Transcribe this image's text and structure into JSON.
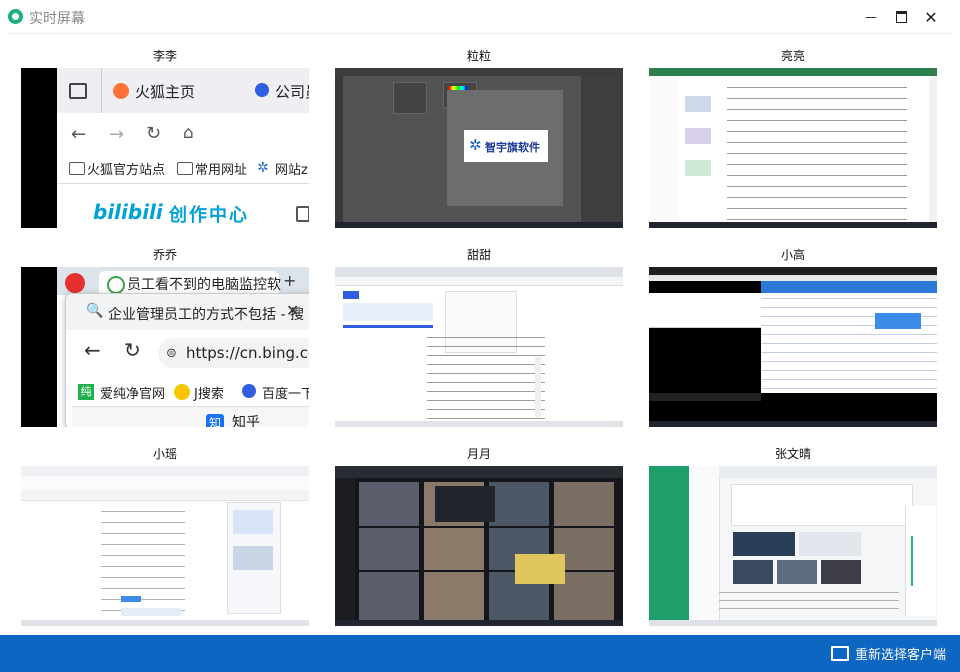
{
  "window": {
    "title": "实时屏幕"
  },
  "footer": {
    "reselect_label": "重新选择客户端"
  },
  "grid": [
    {
      "name": "李李",
      "screen": "firefox",
      "text": {
        "tab1": "火狐主页",
        "tab2": "公司员",
        "bm1": "火狐官方站点",
        "bm2": "常用网址",
        "bm3": "网站z",
        "banner_brand": "bilibili",
        "banner_text": "创作中心"
      }
    },
    {
      "name": "粒粒",
      "screen": "ps",
      "text": {
        "logo": "智宇旗软件"
      }
    },
    {
      "name": "亮亮",
      "screen": "doc",
      "text": {}
    },
    {
      "name": "乔乔",
      "screen": "chrome",
      "text": {
        "tab": "员工看不到的电脑监控软",
        "search": "企业管理员工的方式不包括 - 搜",
        "url": "https://cn.bing.co",
        "bm1": "爱纯净官网",
        "bm2": "J搜索",
        "bm3": "百度一下",
        "card": "知乎"
      }
    },
    {
      "name": "甜甜",
      "screen": "web",
      "text": {}
    },
    {
      "name": "小高",
      "screen": "site",
      "text": {}
    },
    {
      "name": "小瑶",
      "screen": "editor",
      "text": {}
    },
    {
      "name": "月月",
      "screen": "video",
      "text": {}
    },
    {
      "name": "张文晴",
      "screen": "admin",
      "text": {}
    }
  ]
}
